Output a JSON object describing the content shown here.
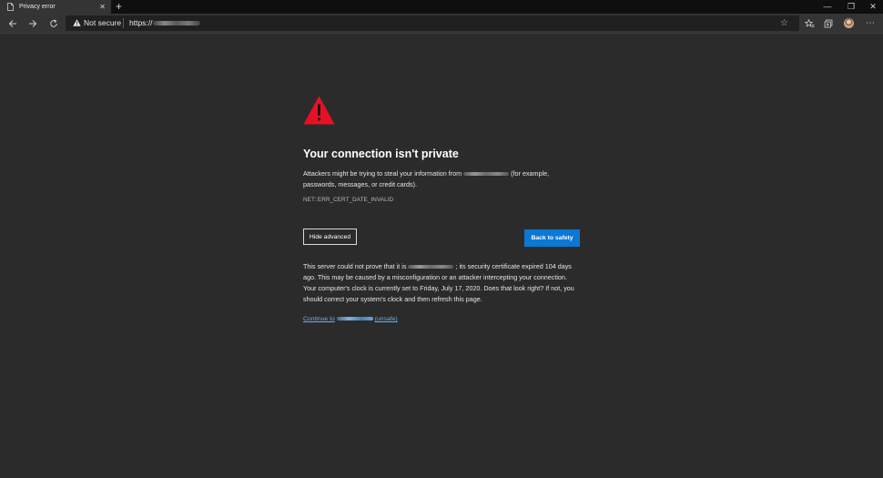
{
  "tab": {
    "title": "Privacy error",
    "close_glyph": "✕",
    "new_tab_glyph": "+"
  },
  "window_controls": {
    "minimize": "—",
    "restore": "❐",
    "close": "✕"
  },
  "omnibox": {
    "security_label": "Not secure",
    "url_prefix": "https://"
  },
  "toolbar_icons": [
    "back-arrow-icon",
    "forward-arrow-icon",
    "refresh-icon",
    "star-icon",
    "favorites-icon",
    "collections-icon",
    "avatar",
    "more-icon"
  ],
  "page": {
    "heading": "Your connection isn't private",
    "description_pre": "Attackers might be trying to steal your information from",
    "description_post": "(for example, passwords, messages, or credit cards).",
    "error_code": "NET::ERR_CERT_DATE_INVALID",
    "hide_advanced_label": "Hide advanced",
    "back_to_safety_label": "Back to safety",
    "details_pre": "This server could not prove that it is",
    "details_post": "; its security certificate expired 104 days ago. This may be caused by a misconfiguration or an attacker intercepting your connection. Your computer's clock is currently set to Friday, July 17, 2020. Does that look right? If not, you should correct your system's clock and then refresh this page.",
    "continue_pre": "Continue to",
    "continue_post": "(unsafe)"
  },
  "colors": {
    "background": "#2b2b2b",
    "warning_red": "#e81123",
    "primary_button": "#0b78d4",
    "link": "#6cb0ea"
  }
}
